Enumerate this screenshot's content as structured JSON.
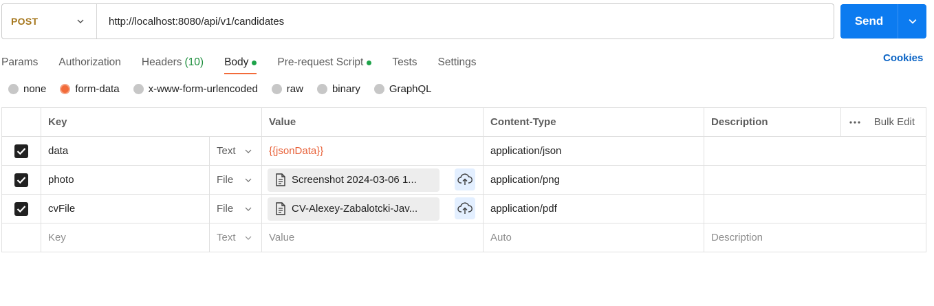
{
  "request": {
    "method": "POST",
    "url": "http://localhost:8080/api/v1/candidates",
    "send_label": "Send"
  },
  "tabs": [
    {
      "label": "Params"
    },
    {
      "label": "Authorization"
    },
    {
      "label": "Headers",
      "count": "(10)"
    },
    {
      "label": "Body"
    },
    {
      "label": "Pre-request Script"
    },
    {
      "label": "Tests"
    },
    {
      "label": "Settings"
    }
  ],
  "cookies_label": "Cookies",
  "body_types": [
    "none",
    "form-data",
    "x-www-form-urlencoded",
    "raw",
    "binary",
    "GraphQL"
  ],
  "table": {
    "headers": {
      "key": "Key",
      "value": "Value",
      "content_type": "Content-Type",
      "description": "Description",
      "bulk_edit": "Bulk Edit"
    },
    "rows": [
      {
        "key": "data",
        "type": "Text",
        "value": "{{jsonData}}",
        "content_type": "application/json"
      },
      {
        "key": "photo",
        "type": "File",
        "value": "Screenshot 2024-03-06 1...",
        "content_type": "application/png"
      },
      {
        "key": "cvFile",
        "type": "File",
        "value": "CV-Alexey-Zabalotcki-Jav...",
        "content_type": "application/pdf"
      }
    ],
    "empty_row": {
      "key": "Key",
      "type": "Text",
      "value": "Value",
      "content_type": "Auto",
      "description": "Description"
    }
  },
  "colors": {
    "send": "#0c7bf0",
    "method": "#a5761b",
    "active_tab_underline": "#f26b3a",
    "variable": "#e8623a",
    "indicator_dot": "#1ea34a",
    "cookies": "#0b64c5"
  }
}
